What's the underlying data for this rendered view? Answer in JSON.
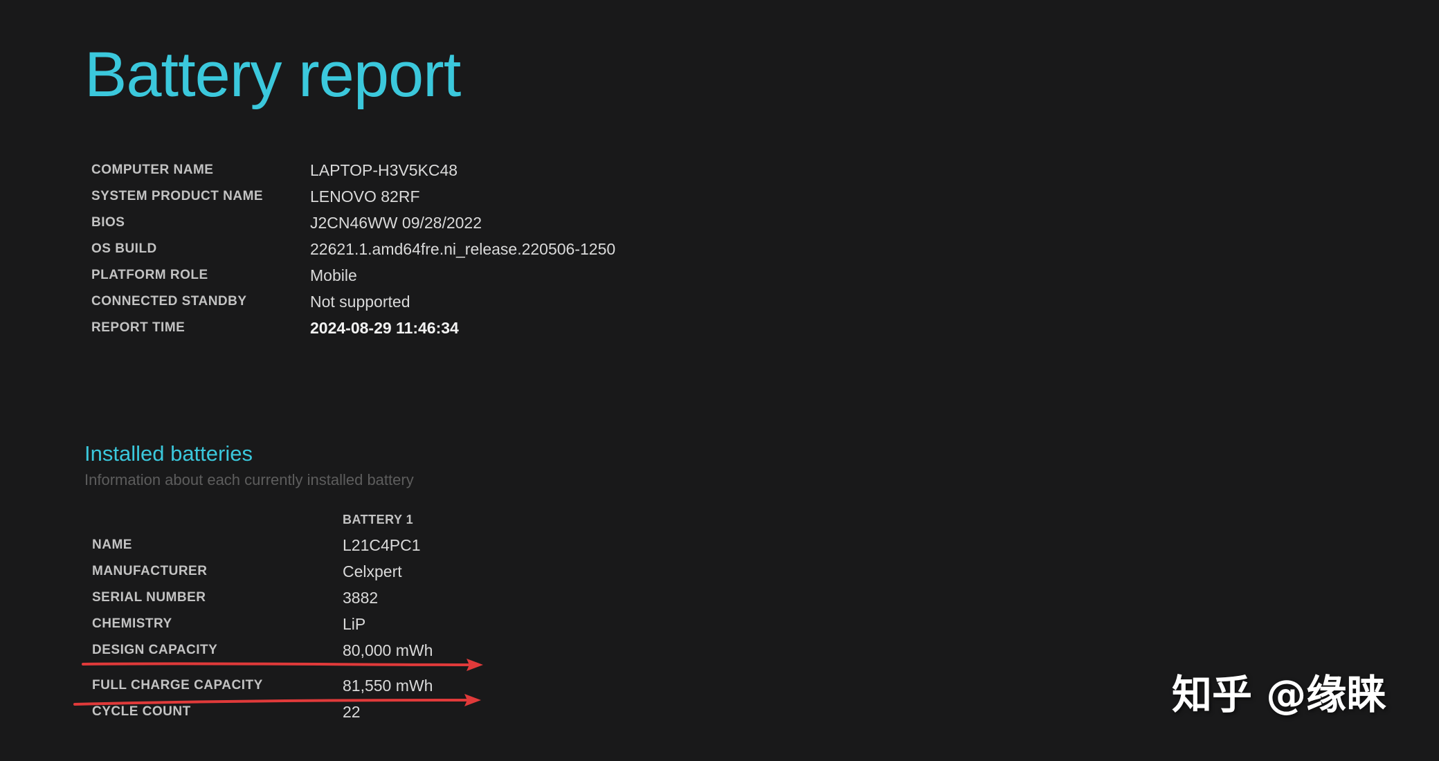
{
  "title": "Battery report",
  "system_info": [
    {
      "label": "COMPUTER NAME",
      "value": "LAPTOP-H3V5KC48"
    },
    {
      "label": "SYSTEM PRODUCT NAME",
      "value": "LENOVO 82RF"
    },
    {
      "label": "BIOS",
      "value": "J2CN46WW 09/28/2022"
    },
    {
      "label": "OS BUILD",
      "value": "22621.1.amd64fre.ni_release.220506-1250"
    },
    {
      "label": "PLATFORM ROLE",
      "value": "Mobile"
    },
    {
      "label": "CONNECTED STANDBY",
      "value": "Not supported"
    },
    {
      "label": "REPORT TIME",
      "value": "2024-08-29  11:46:34"
    }
  ],
  "installed_batteries": {
    "title": "Installed batteries",
    "subtitle": "Information about each currently installed battery",
    "column_header": "BATTERY 1",
    "rows": [
      {
        "label": "NAME",
        "value": "L21C4PC1"
      },
      {
        "label": "MANUFACTURER",
        "value": "Celxpert"
      },
      {
        "label": "SERIAL NUMBER",
        "value": "3882"
      },
      {
        "label": "CHEMISTRY",
        "value": "LiP"
      },
      {
        "label": "DESIGN CAPACITY",
        "value": "80,000 mWh"
      },
      {
        "label": "FULL CHARGE CAPACITY",
        "value": "81,550 mWh"
      },
      {
        "label": "CYCLE COUNT",
        "value": "22"
      }
    ]
  },
  "watermark": "知乎 @缘睐",
  "colors": {
    "background": "#19191a",
    "accent": "#3bc8dc",
    "annotation": "#e03a3a"
  }
}
